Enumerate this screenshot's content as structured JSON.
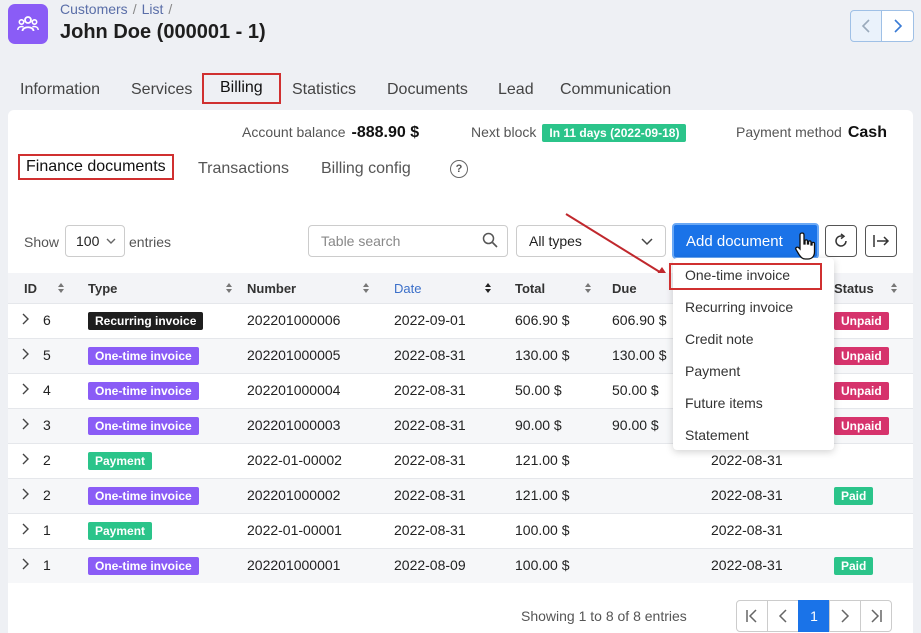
{
  "header": {
    "breadcrumb": [
      "Customers",
      "List"
    ],
    "title": "John Doe (000001 - 1)"
  },
  "tabs": [
    "Information",
    "Services",
    "Billing",
    "Statistics",
    "Documents",
    "Lead",
    "Communication"
  ],
  "summary": {
    "balance_label": "Account balance",
    "balance_value": "-888.90 $",
    "block_label": "Next block",
    "block_value": "In 11 days (2022-09-18)",
    "payment_label": "Payment method",
    "payment_value": "Cash"
  },
  "subtabs": [
    "Finance documents",
    "Transactions",
    "Billing config"
  ],
  "help_icon": "?",
  "toolbar": {
    "show_label": "Show",
    "entries_value": "100",
    "entries_label": "entries",
    "search_placeholder": "Table search",
    "types_value": "All types",
    "add_label": "Add document"
  },
  "table": {
    "columns": [
      "ID",
      "Type",
      "Number",
      "Date",
      "Total",
      "Due",
      "Status"
    ],
    "rows": [
      {
        "id": "6",
        "type": "Recurring invoice",
        "type_kind": "recurring",
        "number": "202201000006",
        "date": "2022-09-01",
        "total": "606.90 $",
        "due": "606.90 $",
        "paid_date": "",
        "status": "Unpaid"
      },
      {
        "id": "5",
        "type": "One-time invoice",
        "type_kind": "onetime",
        "number": "202201000005",
        "date": "2022-08-31",
        "total": "130.00 $",
        "due": "130.00 $",
        "paid_date": "",
        "status": "Unpaid"
      },
      {
        "id": "4",
        "type": "One-time invoice",
        "type_kind": "onetime",
        "number": "202201000004",
        "date": "2022-08-31",
        "total": "50.00 $",
        "due": "50.00 $",
        "paid_date": "",
        "status": "Unpaid"
      },
      {
        "id": "3",
        "type": "One-time invoice",
        "type_kind": "onetime",
        "number": "202201000003",
        "date": "2022-08-31",
        "total": "90.00 $",
        "due": "90.00 $",
        "paid_date": "",
        "status": "Unpaid"
      },
      {
        "id": "2",
        "type": "Payment",
        "type_kind": "payment",
        "number": "2022-01-00002",
        "date": "2022-08-31",
        "total": "121.00 $",
        "due": "",
        "paid_date": "2022-08-31",
        "status": ""
      },
      {
        "id": "2",
        "type": "One-time invoice",
        "type_kind": "onetime",
        "number": "202201000002",
        "date": "2022-08-31",
        "total": "121.00 $",
        "due": "",
        "paid_date": "2022-08-31",
        "status": "Paid"
      },
      {
        "id": "1",
        "type": "Payment",
        "type_kind": "payment",
        "number": "2022-01-00001",
        "date": "2022-08-31",
        "total": "100.00 $",
        "due": "",
        "paid_date": "2022-08-31",
        "status": ""
      },
      {
        "id": "1",
        "type": "One-time invoice",
        "type_kind": "onetime",
        "number": "202201000001",
        "date": "2022-08-09",
        "total": "100.00 $",
        "due": "",
        "paid_date": "2022-08-31",
        "status": "Paid"
      }
    ]
  },
  "dropdown": [
    "One-time invoice",
    "Recurring invoice",
    "Credit note",
    "Payment",
    "Future items",
    "Statement"
  ],
  "footer": {
    "info": "Showing 1 to 8 of 8 entries",
    "current_page": "1"
  },
  "colors": {
    "accent": "#1a73e8",
    "logo": "#8a5cf6",
    "highlight": "#d03030",
    "unpaid": "#d6336c",
    "paid": "#2bc48a"
  }
}
